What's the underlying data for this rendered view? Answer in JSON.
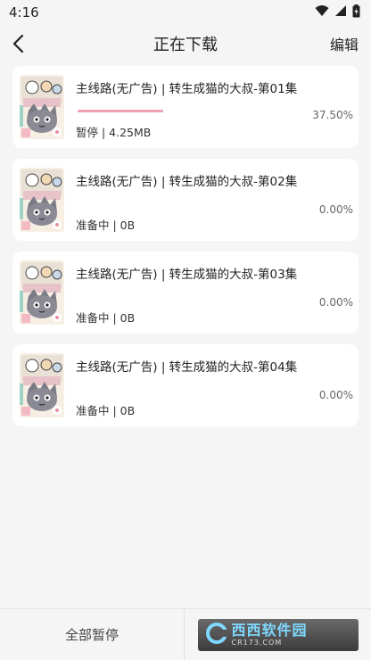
{
  "status_bar": {
    "time": "4:16"
  },
  "header": {
    "title": "正在下载",
    "edit_label": "编辑"
  },
  "downloads": [
    {
      "title": "主线路(无广告) | 转生成猫的大叔-第01集",
      "status": "暂停 | 4.25MB",
      "percent": "37.50%",
      "progress": 0.375
    },
    {
      "title": "主线路(无广告) | 转生成猫的大叔-第02集",
      "status": "准备中 | 0B",
      "percent": "0.00%",
      "progress": 0
    },
    {
      "title": "主线路(无广告) | 转生成猫的大叔-第03集",
      "status": "准备中 | 0B",
      "percent": "0.00%",
      "progress": 0
    },
    {
      "title": "主线路(无广告) | 转生成猫的大叔-第04集",
      "status": "准备中 | 0B",
      "percent": "0.00%",
      "progress": 0
    }
  ],
  "footer": {
    "pause_all_label": "全部暂停"
  },
  "watermark": {
    "main": "西西软件园",
    "sub": "CR173.COM"
  },
  "colors": {
    "progress_fill": "#f0a0b0",
    "progress_track": "#f3c7cf",
    "watermark_accent": "#7fd8ff"
  }
}
